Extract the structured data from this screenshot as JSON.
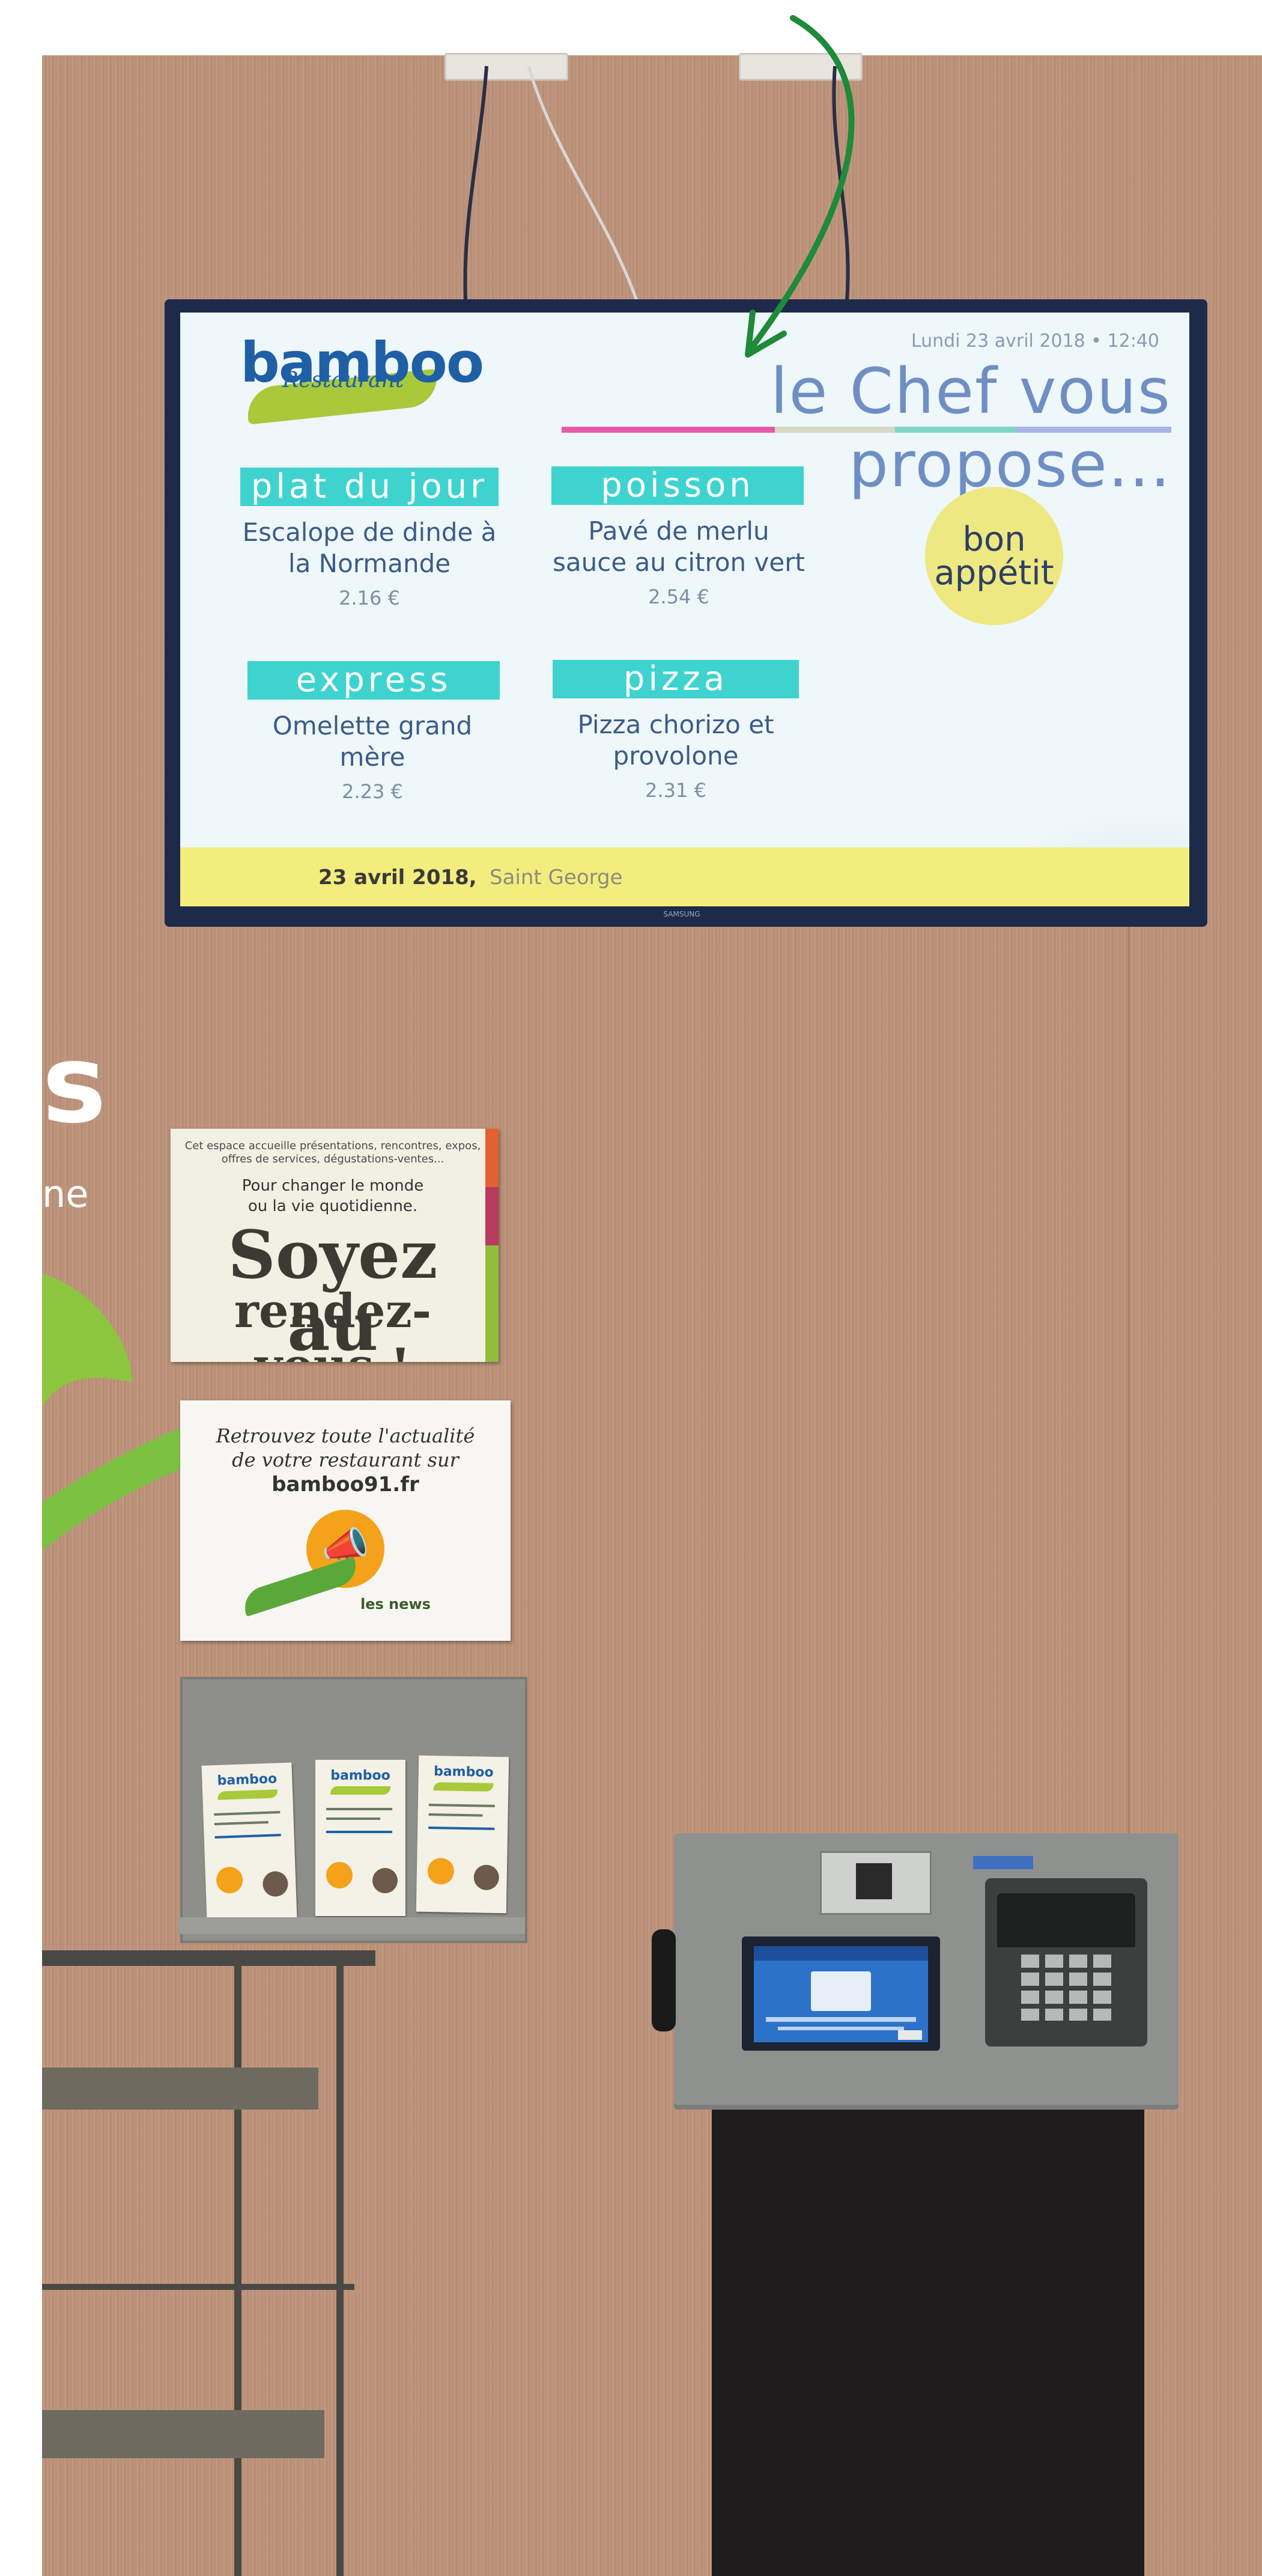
{
  "tv_screen": {
    "logo": {
      "brand": "bamboo",
      "subtitle": "Restaurant"
    },
    "datetime": "Lundi 23 avril 2018 • 12:40",
    "headline": "le Chef vous propose...",
    "menu": [
      {
        "category": "plat du jour",
        "dish_line1": "Escalope de dinde à",
        "dish_line2": "la Normande",
        "price": "2.16 €"
      },
      {
        "category": "poisson",
        "dish_line1": "Pavé de merlu",
        "dish_line2": "sauce au citron vert",
        "price": "2.54 €"
      },
      {
        "category": "express",
        "dish_line1": "Omelette grand",
        "dish_line2": "mère",
        "price": "2.23 €"
      },
      {
        "category": "pizza",
        "dish_line1": "Pizza chorizo et",
        "dish_line2": "provolone",
        "price": "2.31 €"
      }
    ],
    "badge": {
      "line1": "bon",
      "line2": "appétit"
    },
    "footer": {
      "date": "23 avril 2018,",
      "place": "Saint George"
    },
    "tv_brand": "SAMSUNG"
  },
  "wall_text": {
    "letter": "s",
    "word": "ne"
  },
  "poster_rendezvous": {
    "intro": "Cet espace accueille présentations, rencontres, expos, offres de services, dégustations-ventes...",
    "line1": "Pour changer le monde",
    "line2": "ou la vie quotidienne.",
    "big_line1": "Soyez au",
    "big_line2": "rendez-vous !"
  },
  "poster_news": {
    "line1": "Retrouvez toute l'actualité",
    "line2": "de votre restaurant sur",
    "site": "bamboo91.fr",
    "label": "les news"
  },
  "brochures": [
    {
      "title": "bamboo"
    },
    {
      "title": "bamboo"
    },
    {
      "title": "bamboo"
    }
  ],
  "colors": {
    "wall": "#bc937a",
    "category_band": "#3fd3d0",
    "arrow": "#1e8a3a",
    "footer_band": "#f3ed7e"
  },
  "icons": [
    "megaphone-icon",
    "arrow-icon"
  ]
}
